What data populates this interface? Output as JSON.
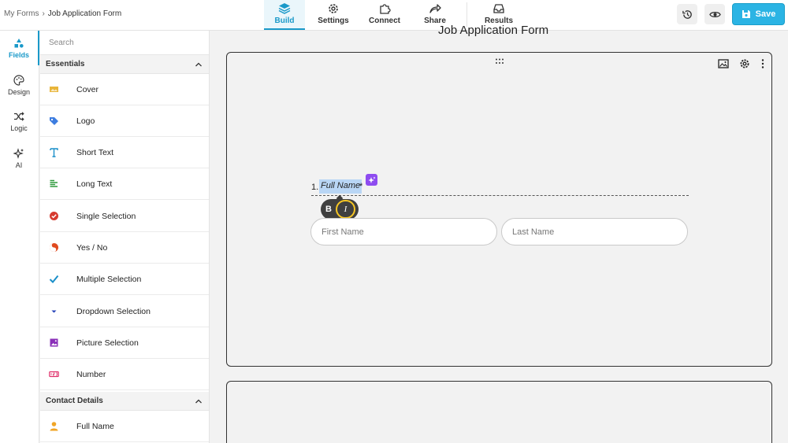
{
  "breadcrumb": {
    "home": "My Forms",
    "separator": "›",
    "current": "Job Application Form"
  },
  "nav_tabs": [
    {
      "label": "Build",
      "icon": "layers-icon",
      "active": true
    },
    {
      "label": "Settings",
      "icon": "gear-icon",
      "active": false
    },
    {
      "label": "Connect",
      "icon": "puzzle-icon",
      "active": false
    },
    {
      "label": "Share",
      "icon": "share-icon",
      "active": false
    },
    {
      "label": "Results",
      "icon": "inbox-icon",
      "active": false
    }
  ],
  "toolbar": {
    "history_icon": "history-icon",
    "preview_icon": "eye-icon",
    "save_label": "Save"
  },
  "rail": [
    {
      "label": "Fields",
      "icon": "shapes-icon",
      "active": true
    },
    {
      "label": "Design",
      "icon": "palette-icon",
      "active": false
    },
    {
      "label": "Logic",
      "icon": "shuffle-icon",
      "active": false
    },
    {
      "label": "AI",
      "icon": "sparkle-icon",
      "active": false
    }
  ],
  "panel": {
    "search_placeholder": "Search",
    "sections": [
      {
        "title": "Essentials",
        "expanded": true
      },
      {
        "title": "Contact Details",
        "expanded": true
      }
    ],
    "essentials": [
      {
        "label": "Cover",
        "icon": "image-icon",
        "color": "#e8b53a"
      },
      {
        "label": "Logo",
        "icon": "tag-icon",
        "color": "#3d7de0"
      },
      {
        "label": "Short Text",
        "icon": "text-icon",
        "color": "#1a8fc9"
      },
      {
        "label": "Long Text",
        "icon": "paragraph-icon",
        "color": "#2e9a3b"
      },
      {
        "label": "Single Selection",
        "icon": "check-circle-icon",
        "color": "#d63a2f"
      },
      {
        "label": "Yes / No",
        "icon": "yes-no-icon",
        "color": "#e04a1f"
      },
      {
        "label": "Multiple Selection",
        "icon": "checkmark-icon",
        "color": "#1a8fc9"
      },
      {
        "label": "Dropdown Selection",
        "icon": "caret-down-icon",
        "color": "#2340b8"
      },
      {
        "label": "Picture Selection",
        "icon": "picture-icon",
        "color": "#8a2fb8"
      },
      {
        "label": "Number",
        "icon": "number-icon",
        "color": "#e0306b"
      }
    ],
    "contact": [
      {
        "label": "Full Name",
        "icon": "person-icon",
        "color": "#f0a526"
      }
    ]
  },
  "canvas": {
    "form_title": "Job Application Form",
    "question": {
      "number": "1.",
      "label": "Full Name",
      "required_mark": "*",
      "format_bold": "B",
      "format_italic": "I",
      "fields": [
        {
          "placeholder": "First Name"
        },
        {
          "placeholder": "Last Name"
        }
      ]
    }
  },
  "colors": {
    "accent": "#1a99c9",
    "save": "#2bb4e4",
    "ai": "#8e4cf0",
    "highlight": "#b9d6f5"
  }
}
